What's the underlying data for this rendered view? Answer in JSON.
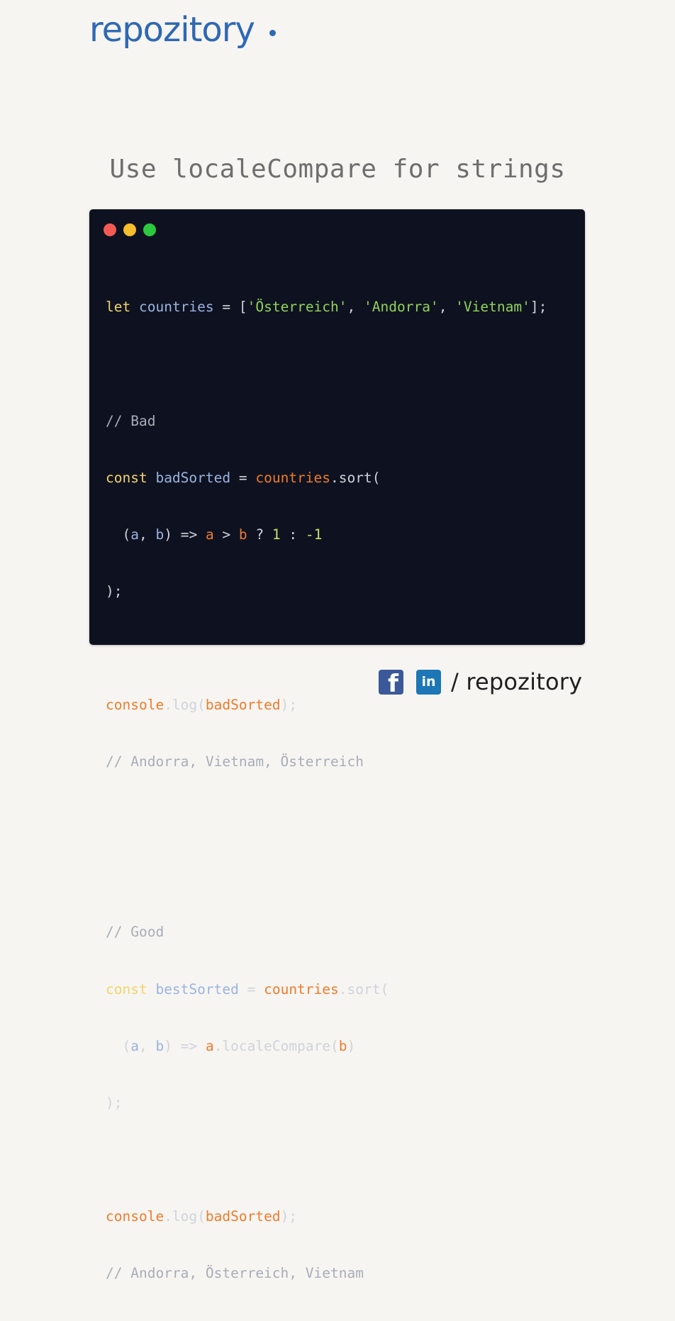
{
  "brand": {
    "logo_text": "repozitory",
    "logo_color": "#2f68b4"
  },
  "headline": "Use localeCompare for strings",
  "editor": {
    "window_dots": [
      {
        "name": "close",
        "color": "#f35a54"
      },
      {
        "name": "minimize",
        "color": "#f6bd2c"
      },
      {
        "name": "maximize",
        "color": "#2bc93f"
      }
    ],
    "code": {
      "l1": {
        "kw": "let",
        "name": "countries",
        "eq": " = ",
        "open": "[",
        "s1": "'Österreich'",
        "c1": ", ",
        "s2": "'Andorra'",
        "c2": ", ",
        "s3": "'Vietnam'",
        "close": "];"
      },
      "l2_comment": "// Bad",
      "l3": {
        "kw": "const",
        "name": "badSorted",
        "eq": " = ",
        "obj": "countries",
        "call": ".sort("
      },
      "l4": {
        "indent": "  ",
        "params_open": "(",
        "a": "a",
        "comma": ", ",
        "b": "b",
        "params_close": ")",
        "arrow": " => ",
        "ra": "a",
        "gt": " > ",
        "rb": "b",
        "q": " ? ",
        "one": "1",
        "colon": " : ",
        "neg": "-1"
      },
      "l5": ");",
      "l6": {
        "obj": "console",
        "call": ".log(",
        "arg": "badSorted",
        "close": ");"
      },
      "l7_comment": "// Andorra, Vietnam, Österreich",
      "l8_comment": "// Good",
      "l9": {
        "kw": "const",
        "name": "bestSorted",
        "eq": " = ",
        "obj": "countries",
        "call": ".sort("
      },
      "l10": {
        "indent": "  ",
        "params_open": "(",
        "a": "a",
        "comma": ", ",
        "b": "b",
        "params_close": ")",
        "arrow": " => ",
        "ra": "a",
        "method": ".localeCompare(",
        "rb": "b",
        "close": ")"
      },
      "l11": ");",
      "l12": {
        "obj": "console",
        "call": ".log(",
        "arg": "badSorted",
        "close": ");"
      },
      "l13_comment": "// Andorra, Österreich, Vietnam"
    },
    "colors": {
      "background": "#0e1220",
      "keyword": "#f2d46b",
      "variable": "#9ab4e0",
      "string": "#91d35a",
      "number": "#c9e06a",
      "object": "#ef7b2c",
      "comment": "#a8adb6"
    }
  },
  "footer": {
    "facebook_icon": "facebook-icon",
    "facebook_glyph": "f",
    "linkedin_icon": "linkedin-icon",
    "linkedin_glyph": "in",
    "handle": "/ repozitory"
  }
}
